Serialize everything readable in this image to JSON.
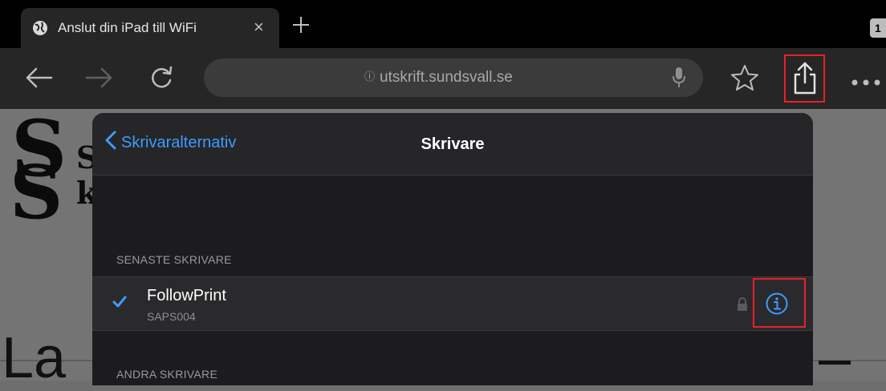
{
  "tab": {
    "title": "Anslut din iPad till WiFi",
    "close": "×",
    "count": "1"
  },
  "toolbar": {
    "url": "utskrift.sundsvall.se",
    "url_info": "ⓘ"
  },
  "popover": {
    "back_label": "Skrivaralternativ",
    "title": "Skrivare",
    "recent_header": "SENASTE SKRIVARE",
    "other_header": "ANDRA SKRIVARE",
    "printers": [
      {
        "name": "FollowPrint",
        "id": "SAPS004",
        "selected": true,
        "locked": true
      }
    ]
  },
  "background_page": {
    "logo_s1": "S",
    "logo_s2": "S",
    "logo_k": "k",
    "logo_s_small": "S",
    "heading_partial": "La",
    "heading_tail": "–"
  },
  "colors": {
    "accent": "#3e9bff",
    "highlight": "#e8202a",
    "popover_bg": "#1c1c1e"
  },
  "icons": [
    "globe-icon",
    "plus-icon",
    "back-arrow-icon",
    "forward-arrow-icon",
    "reload-icon",
    "microphone-icon",
    "star-icon",
    "share-icon",
    "more-icon",
    "chevron-left-icon",
    "checkmark-icon",
    "lock-icon",
    "info-icon"
  ]
}
